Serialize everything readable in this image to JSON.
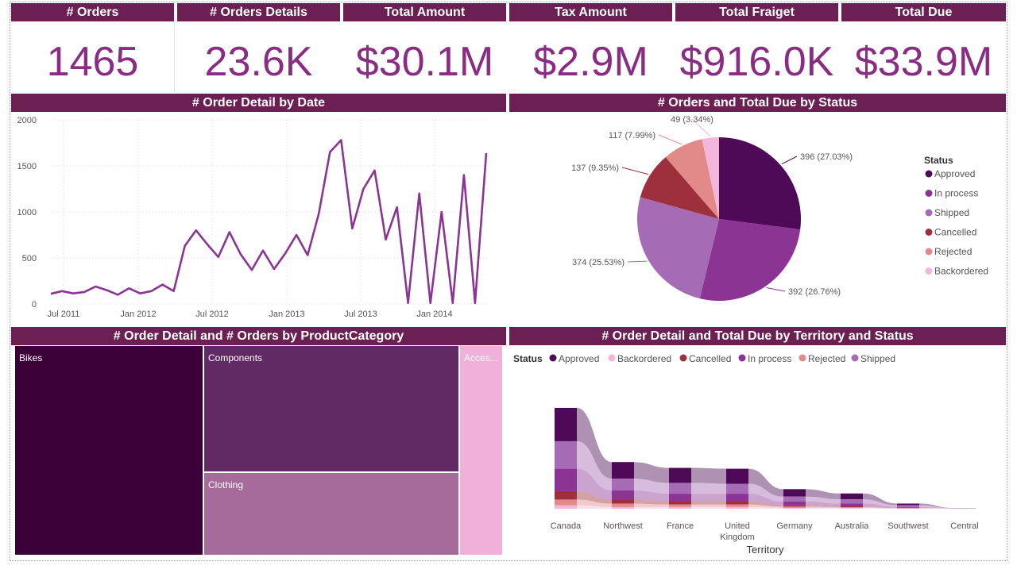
{
  "kpis": [
    {
      "title": "# Orders",
      "value": "1465"
    },
    {
      "title": "# Orders Details",
      "value": "23.6K"
    },
    {
      "title": "Total Amount",
      "value": "$30.1M"
    },
    {
      "title": "Tax Amount",
      "value": "$2.9M"
    },
    {
      "title": "Total Fraiget",
      "value": "$916.0K"
    },
    {
      "title": "Total Due",
      "value": "$33.9M"
    }
  ],
  "colors": {
    "header_bg": "#6b1f52",
    "kpi_text": "#8a2c83",
    "approved": "#4e0a56",
    "in_process": "#8b3494",
    "shipped": "#a66bb5",
    "cancelled": "#9e2f3c",
    "rejected": "#e28a8a",
    "backordered": "#f2b6dc"
  },
  "line_chart": {
    "title": "# Order Detail by Date",
    "y_ticks": [
      "0",
      "500",
      "1000",
      "1500",
      "2000"
    ],
    "x_ticks": [
      "Jul 2011",
      "Jan 2012",
      "Jul 2012",
      "Jan 2013",
      "Jul 2013",
      "Jan 2014"
    ]
  },
  "pie_chart": {
    "title": "# Orders and Total Due by Status",
    "legend_title": "Status",
    "slice_labels": [
      "396 (27.03%)",
      "392 (26.76%)",
      "374 (25.53%)",
      "137 (9.35%)",
      "117 (7.99%)",
      "49 (3.34%)"
    ]
  },
  "treemap": {
    "title": "# Order Detail and # Orders by ProductCategory",
    "labels": [
      "Bikes",
      "Components",
      "Clothing",
      "Acces..."
    ]
  },
  "ribbon": {
    "title": "# Order Detail and Total Due by Territory and Status",
    "legend_title": "Status",
    "legend_items": [
      "Approved",
      "Backordered",
      "Cancelled",
      "In process",
      "Rejected",
      "Shipped"
    ],
    "x_axis_title": "Territory",
    "territories": [
      "Canada",
      "Northwest",
      "France",
      "United Kingdom",
      "Germany",
      "Australia",
      "Southwest",
      "Central"
    ]
  },
  "chart_data": [
    {
      "type": "line",
      "title": "# Order Detail by Date",
      "xlabel": "",
      "ylabel": "",
      "ylim": [
        0,
        2000
      ],
      "x": [
        "2011-06",
        "2011-07",
        "2011-08",
        "2011-09",
        "2011-10",
        "2011-11",
        "2011-12",
        "2012-01",
        "2012-02",
        "2012-03",
        "2012-04",
        "2012-05",
        "2012-06",
        "2012-07",
        "2012-08",
        "2012-09",
        "2012-10",
        "2012-11",
        "2012-12",
        "2013-01",
        "2013-02",
        "2013-03",
        "2013-04",
        "2013-05",
        "2013-06",
        "2013-07",
        "2013-08",
        "2013-09",
        "2013-10",
        "2013-11",
        "2013-12",
        "2014-01",
        "2014-02",
        "2014-03",
        "2014-04",
        "2014-05",
        "2014-06"
      ],
      "series": [
        {
          "values": [
            110,
            140,
            115,
            130,
            190,
            150,
            100,
            170,
            115,
            140,
            210,
            140,
            630,
            800,
            650,
            510,
            780,
            540,
            370,
            580,
            380,
            550,
            750,
            530,
            980,
            1650,
            1780,
            820,
            1250,
            1450,
            700,
            1050,
            10,
            1200,
            10,
            1000,
            10,
            1400,
            10,
            1640
          ]
        }
      ]
    },
    {
      "type": "pie",
      "title": "# Orders and Total Due by Status",
      "legend": "right",
      "categories": [
        "Approved",
        "In process",
        "Shipped",
        "Cancelled",
        "Rejected",
        "Backordered"
      ],
      "values": [
        396,
        392,
        374,
        137,
        117,
        49
      ],
      "percents": [
        27.03,
        26.76,
        25.53,
        9.35,
        7.99,
        3.34
      ]
    },
    {
      "type": "treemap",
      "title": "# Order Detail and # Orders by ProductCategory",
      "categories": [
        "Bikes",
        "Components",
        "Clothing",
        "Acces..."
      ],
      "shares": [
        0.39,
        0.3,
        0.2,
        0.09
      ]
    },
    {
      "type": "ribbon",
      "title": "# Order Detail and Total Due by Territory and Status",
      "xlabel": "Territory",
      "legend": "top-left",
      "categories": [
        "Canada",
        "Northwest",
        "France",
        "United Kingdom",
        "Germany",
        "Australia",
        "Southwest",
        "Central"
      ],
      "series": [
        {
          "name": "Approved",
          "values": [
            40,
            20,
            18,
            18,
            9,
            7,
            2,
            0.3
          ]
        },
        {
          "name": "Shipped",
          "values": [
            33,
            14,
            13,
            12,
            6,
            5,
            2,
            0.2
          ]
        },
        {
          "name": "In process",
          "values": [
            27,
            11,
            9,
            9,
            4,
            3,
            1,
            0.1
          ]
        },
        {
          "name": "Cancelled",
          "values": [
            10,
            5,
            4,
            4,
            2,
            1.5,
            0.5,
            0.1
          ]
        },
        {
          "name": "Rejected",
          "values": [
            7,
            4,
            3,
            3,
            1.5,
            1,
            0.4,
            0.1
          ]
        },
        {
          "name": "Backordered",
          "values": [
            4,
            2,
            2,
            2,
            1,
            0.8,
            0.3,
            0.1
          ]
        }
      ]
    }
  ]
}
